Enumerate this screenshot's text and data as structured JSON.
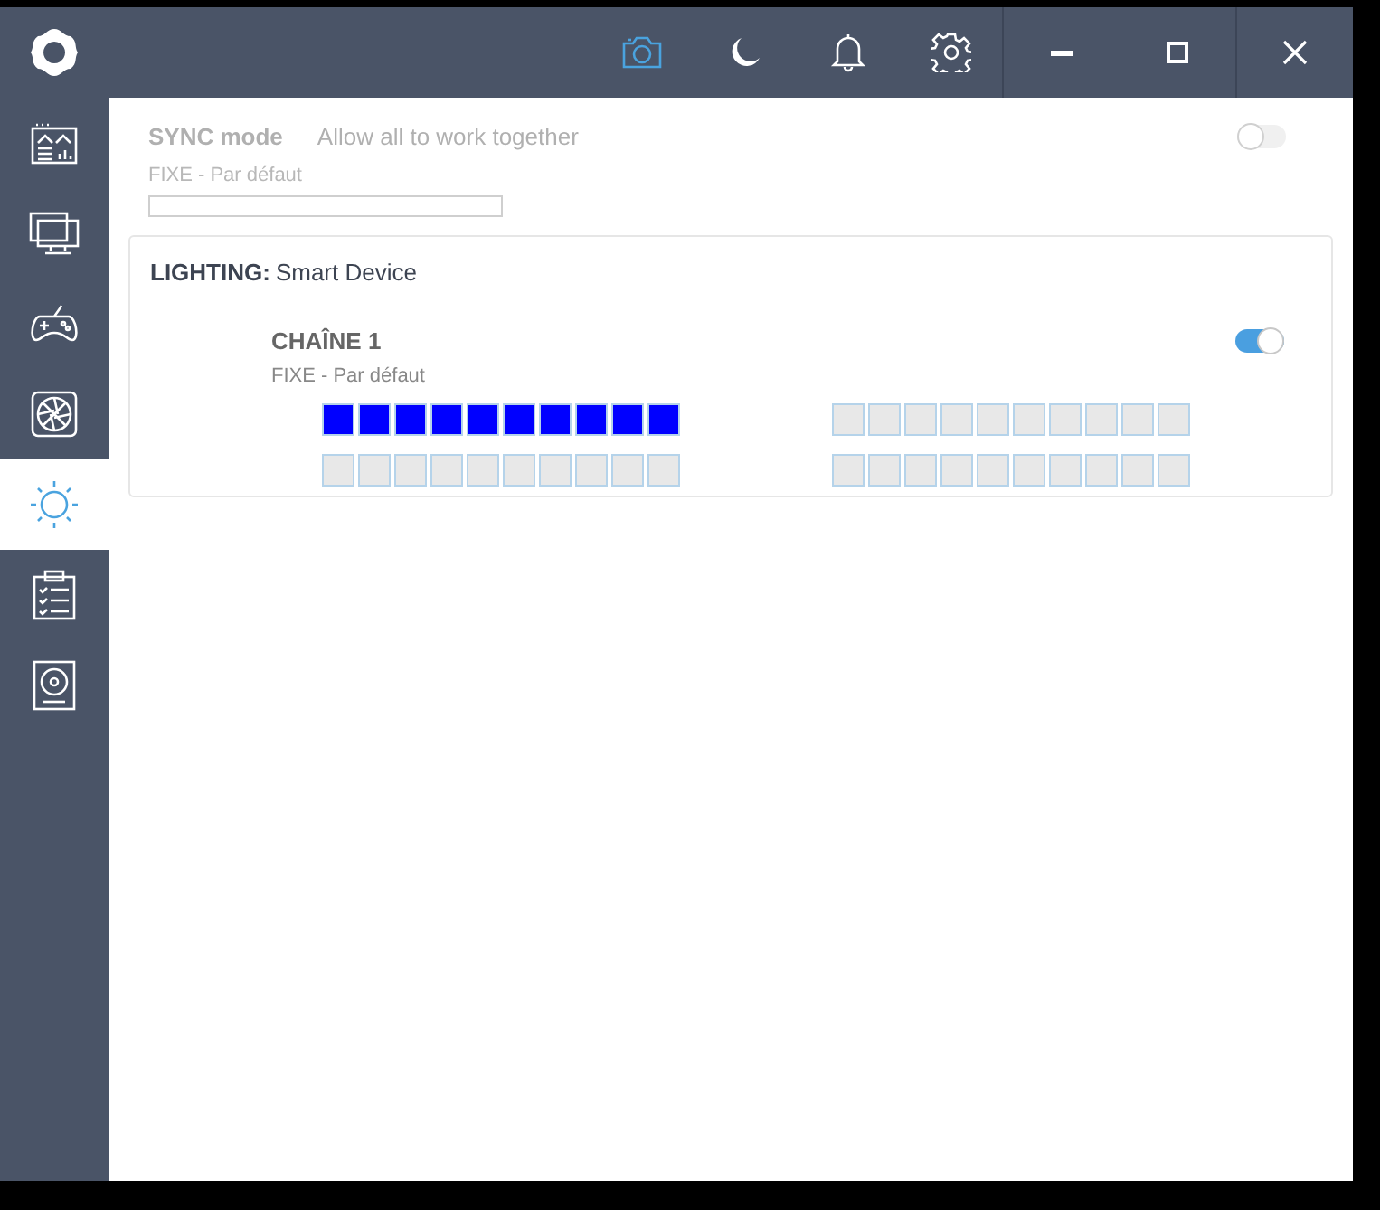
{
  "sidebar": {
    "items": [
      {
        "kind": "dashboard",
        "selected": false
      },
      {
        "kind": "monitor",
        "selected": false
      },
      {
        "kind": "gamepad",
        "selected": false
      },
      {
        "kind": "fan",
        "selected": false
      },
      {
        "kind": "sun",
        "selected": true
      },
      {
        "kind": "checklist",
        "selected": false
      },
      {
        "kind": "speaker",
        "selected": false
      }
    ]
  },
  "toolbar": {
    "items": [
      {
        "kind": "camera",
        "selected": true
      },
      {
        "kind": "moon",
        "selected": false
      },
      {
        "kind": "bell",
        "selected": false
      },
      {
        "kind": "gear",
        "selected": false
      }
    ]
  },
  "sync": {
    "label": "SYNC mode",
    "description": "Allow all to work together",
    "mode": "FIXE - Par défaut",
    "on": false
  },
  "lighting": {
    "label": "LIGHTING:",
    "device": "Smart Device",
    "channels": [
      {
        "name": "CHAÎNE 1",
        "mode": "FIXE - Par défaut",
        "on": true,
        "led_groups": [
          {
            "leds": [
              {
                "color": "#0000ff"
              },
              {
                "color": "#0000ff"
              },
              {
                "color": "#0000ff"
              },
              {
                "color": "#0000ff"
              },
              {
                "color": "#0000ff"
              },
              {
                "color": "#0000ff"
              },
              {
                "color": "#0000ff"
              },
              {
                "color": "#0000ff"
              },
              {
                "color": "#0000ff"
              },
              {
                "color": "#0000ff"
              }
            ]
          },
          {
            "leds": [
              {
                "color": "#e8e8e8"
              },
              {
                "color": "#e8e8e8"
              },
              {
                "color": "#e8e8e8"
              },
              {
                "color": "#e8e8e8"
              },
              {
                "color": "#e8e8e8"
              },
              {
                "color": "#e8e8e8"
              },
              {
                "color": "#e8e8e8"
              },
              {
                "color": "#e8e8e8"
              },
              {
                "color": "#e8e8e8"
              },
              {
                "color": "#e8e8e8"
              }
            ]
          },
          {
            "leds": [
              {
                "color": "#e8e8e8"
              },
              {
                "color": "#e8e8e8"
              },
              {
                "color": "#e8e8e8"
              },
              {
                "color": "#e8e8e8"
              },
              {
                "color": "#e8e8e8"
              },
              {
                "color": "#e8e8e8"
              },
              {
                "color": "#e8e8e8"
              },
              {
                "color": "#e8e8e8"
              },
              {
                "color": "#e8e8e8"
              },
              {
                "color": "#e8e8e8"
              }
            ]
          },
          {
            "leds": [
              {
                "color": "#e8e8e8"
              },
              {
                "color": "#e8e8e8"
              },
              {
                "color": "#e8e8e8"
              },
              {
                "color": "#e8e8e8"
              },
              {
                "color": "#e8e8e8"
              },
              {
                "color": "#e8e8e8"
              },
              {
                "color": "#e8e8e8"
              },
              {
                "color": "#e8e8e8"
              },
              {
                "color": "#e8e8e8"
              },
              {
                "color": "#e8e8e8"
              }
            ]
          }
        ]
      }
    ]
  }
}
